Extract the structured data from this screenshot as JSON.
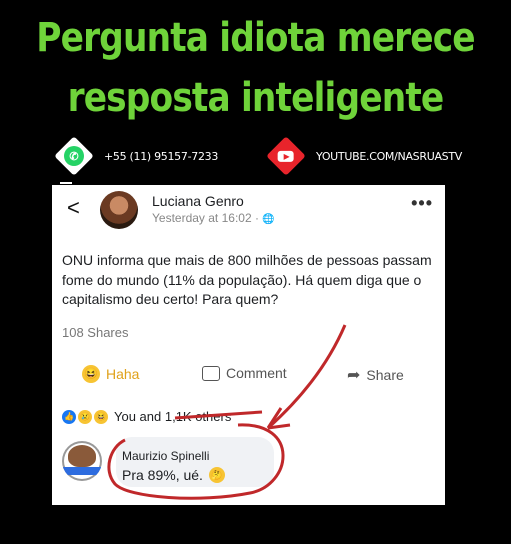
{
  "headline": {
    "line1": "Pergunta idiota merece",
    "line2": "resposta inteligente"
  },
  "contacts": {
    "whatsapp": {
      "icon": "whatsapp-icon",
      "text": "+55 (11) 95157-7233",
      "color": "#25d366"
    },
    "youtube": {
      "icon": "youtube-icon",
      "text": "YOUTUBE.COM/NASRUASTV",
      "color": "#e8242b"
    }
  },
  "post": {
    "back_glyph": "<",
    "author": "Luciana Genro",
    "meta": "Yesterday at 16:02 · ",
    "globe_glyph": "🌐",
    "more_glyph": "•••",
    "text": "ONU informa que mais de 800 milhões de pessoas passam fome do mundo (11% da população). Há quem diga que o capitalismo deu certo! Para quem?",
    "shares": "108 Shares",
    "actions": {
      "haha": "Haha",
      "comment": "Comment",
      "share": "Share"
    },
    "reactions_text": "You and 1,1K others",
    "comment": {
      "author": "Maurizio Spinelli",
      "text": "Pra 89%, ué."
    }
  },
  "colors": {
    "headline": "#6fd33a",
    "background": "#000000",
    "annotation": "#c0282a",
    "haha": "#e0a21b"
  }
}
